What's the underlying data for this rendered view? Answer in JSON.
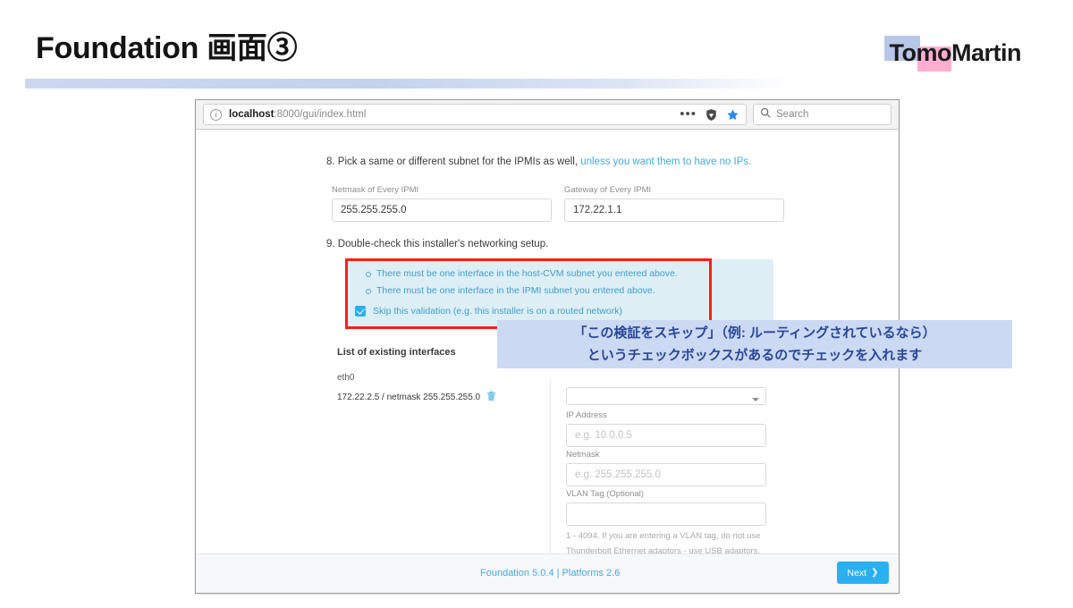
{
  "slide": {
    "title": "Foundation 画面③",
    "logo": {
      "text_first": "Tomo",
      "text_second": "Martin",
      "blue": "#b7c7e8",
      "pink": "#ffaed2"
    }
  },
  "browser": {
    "url_host": "localhost",
    "url_rest": ":8000/gui/index.html",
    "menu_dots": "•••",
    "search_placeholder": "Search",
    "icons": {
      "info": "ⓘ",
      "shield": "shield-icon",
      "star": "star-icon",
      "search": "search-icon"
    }
  },
  "page": {
    "step8": {
      "text": "8. Pick a same or different subnet for the IPMIs as well,",
      "link": "unless you want them to have no IPs.",
      "fields": [
        {
          "label": "Netmask of Every IPMI",
          "value": "255.255.255.0"
        },
        {
          "label": "Gateway of Every IPMI",
          "value": "172.22.1.1"
        }
      ]
    },
    "step9": {
      "text": "9. Double-check this installer's networking setup.",
      "validations": [
        "There must be one interface in the host-CVM subnet you entered above.",
        "There must be one interface in the IPMI subnet you entered above."
      ],
      "skip_checkbox": {
        "label": "Skip this validation (e.g. this installer is on a routed network)",
        "checked": true
      },
      "highlight_color": "#ff1d15",
      "panel_color": "#ddeef4"
    },
    "interfaces": {
      "title": "List of existing interfaces",
      "items": [
        {
          "name": "eth0",
          "detail": "172.22.2.5 / netmask 255.255.255.0",
          "delete_icon": "trash-icon"
        }
      ]
    },
    "form": {
      "fields": [
        {
          "label": "IP Address",
          "placeholder": "e.g. 10.0.0.5",
          "value": ""
        },
        {
          "label": "Netmask",
          "placeholder": "e.g. 255.255.255.0",
          "value": ""
        },
        {
          "label": "VLAN Tag (Optional)",
          "placeholder": "",
          "value": ""
        }
      ],
      "helper_line1": "1 - 4094. If you are entering a VLAN tag, do not use",
      "helper_line2": "Thunderbolt Ethernet adaptors - use USB adaptors."
    },
    "footer": {
      "version_text": "Foundation 5.0.4  |  Platforms 2.6",
      "next_label": "Next",
      "next_arrow": "❯",
      "accent": "#2ab0ef"
    }
  },
  "annotation": {
    "line1": "「この検証をスキップ」（例: ルーティングされているなら）",
    "line2": "というチェックボックスがあるのでチェックを入れます",
    "bg": "#ccd9f2",
    "fg": "#27489a"
  }
}
